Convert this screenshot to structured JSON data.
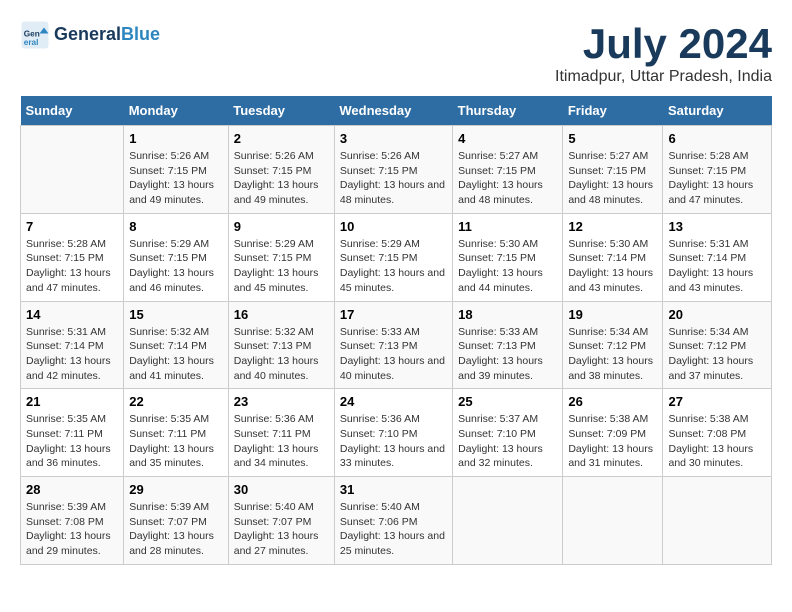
{
  "logo": {
    "line1": "General",
    "line2": "Blue"
  },
  "title": "July 2024",
  "subtitle": "Itimadpur, Uttar Pradesh, India",
  "days_of_week": [
    "Sunday",
    "Monday",
    "Tuesday",
    "Wednesday",
    "Thursday",
    "Friday",
    "Saturday"
  ],
  "weeks": [
    [
      {
        "day": "",
        "sunrise": "",
        "sunset": "",
        "daylight": ""
      },
      {
        "day": "1",
        "sunrise": "5:26 AM",
        "sunset": "7:15 PM",
        "daylight": "13 hours and 49 minutes."
      },
      {
        "day": "2",
        "sunrise": "5:26 AM",
        "sunset": "7:15 PM",
        "daylight": "13 hours and 49 minutes."
      },
      {
        "day": "3",
        "sunrise": "5:26 AM",
        "sunset": "7:15 PM",
        "daylight": "13 hours and 48 minutes."
      },
      {
        "day": "4",
        "sunrise": "5:27 AM",
        "sunset": "7:15 PM",
        "daylight": "13 hours and 48 minutes."
      },
      {
        "day": "5",
        "sunrise": "5:27 AM",
        "sunset": "7:15 PM",
        "daylight": "13 hours and 48 minutes."
      },
      {
        "day": "6",
        "sunrise": "5:28 AM",
        "sunset": "7:15 PM",
        "daylight": "13 hours and 47 minutes."
      }
    ],
    [
      {
        "day": "7",
        "sunrise": "5:28 AM",
        "sunset": "7:15 PM",
        "daylight": "13 hours and 47 minutes."
      },
      {
        "day": "8",
        "sunrise": "5:29 AM",
        "sunset": "7:15 PM",
        "daylight": "13 hours and 46 minutes."
      },
      {
        "day": "9",
        "sunrise": "5:29 AM",
        "sunset": "7:15 PM",
        "daylight": "13 hours and 45 minutes."
      },
      {
        "day": "10",
        "sunrise": "5:29 AM",
        "sunset": "7:15 PM",
        "daylight": "13 hours and 45 minutes."
      },
      {
        "day": "11",
        "sunrise": "5:30 AM",
        "sunset": "7:15 PM",
        "daylight": "13 hours and 44 minutes."
      },
      {
        "day": "12",
        "sunrise": "5:30 AM",
        "sunset": "7:14 PM",
        "daylight": "13 hours and 43 minutes."
      },
      {
        "day": "13",
        "sunrise": "5:31 AM",
        "sunset": "7:14 PM",
        "daylight": "13 hours and 43 minutes."
      }
    ],
    [
      {
        "day": "14",
        "sunrise": "5:31 AM",
        "sunset": "7:14 PM",
        "daylight": "13 hours and 42 minutes."
      },
      {
        "day": "15",
        "sunrise": "5:32 AM",
        "sunset": "7:14 PM",
        "daylight": "13 hours and 41 minutes."
      },
      {
        "day": "16",
        "sunrise": "5:32 AM",
        "sunset": "7:13 PM",
        "daylight": "13 hours and 40 minutes."
      },
      {
        "day": "17",
        "sunrise": "5:33 AM",
        "sunset": "7:13 PM",
        "daylight": "13 hours and 40 minutes."
      },
      {
        "day": "18",
        "sunrise": "5:33 AM",
        "sunset": "7:13 PM",
        "daylight": "13 hours and 39 minutes."
      },
      {
        "day": "19",
        "sunrise": "5:34 AM",
        "sunset": "7:12 PM",
        "daylight": "13 hours and 38 minutes."
      },
      {
        "day": "20",
        "sunrise": "5:34 AM",
        "sunset": "7:12 PM",
        "daylight": "13 hours and 37 minutes."
      }
    ],
    [
      {
        "day": "21",
        "sunrise": "5:35 AM",
        "sunset": "7:11 PM",
        "daylight": "13 hours and 36 minutes."
      },
      {
        "day": "22",
        "sunrise": "5:35 AM",
        "sunset": "7:11 PM",
        "daylight": "13 hours and 35 minutes."
      },
      {
        "day": "23",
        "sunrise": "5:36 AM",
        "sunset": "7:11 PM",
        "daylight": "13 hours and 34 minutes."
      },
      {
        "day": "24",
        "sunrise": "5:36 AM",
        "sunset": "7:10 PM",
        "daylight": "13 hours and 33 minutes."
      },
      {
        "day": "25",
        "sunrise": "5:37 AM",
        "sunset": "7:10 PM",
        "daylight": "13 hours and 32 minutes."
      },
      {
        "day": "26",
        "sunrise": "5:38 AM",
        "sunset": "7:09 PM",
        "daylight": "13 hours and 31 minutes."
      },
      {
        "day": "27",
        "sunrise": "5:38 AM",
        "sunset": "7:08 PM",
        "daylight": "13 hours and 30 minutes."
      }
    ],
    [
      {
        "day": "28",
        "sunrise": "5:39 AM",
        "sunset": "7:08 PM",
        "daylight": "13 hours and 29 minutes."
      },
      {
        "day": "29",
        "sunrise": "5:39 AM",
        "sunset": "7:07 PM",
        "daylight": "13 hours and 28 minutes."
      },
      {
        "day": "30",
        "sunrise": "5:40 AM",
        "sunset": "7:07 PM",
        "daylight": "13 hours and 27 minutes."
      },
      {
        "day": "31",
        "sunrise": "5:40 AM",
        "sunset": "7:06 PM",
        "daylight": "13 hours and 25 minutes."
      },
      {
        "day": "",
        "sunrise": "",
        "sunset": "",
        "daylight": ""
      },
      {
        "day": "",
        "sunrise": "",
        "sunset": "",
        "daylight": ""
      },
      {
        "day": "",
        "sunrise": "",
        "sunset": "",
        "daylight": ""
      }
    ]
  ],
  "labels": {
    "sunrise": "Sunrise:",
    "sunset": "Sunset:",
    "daylight": "Daylight:"
  }
}
